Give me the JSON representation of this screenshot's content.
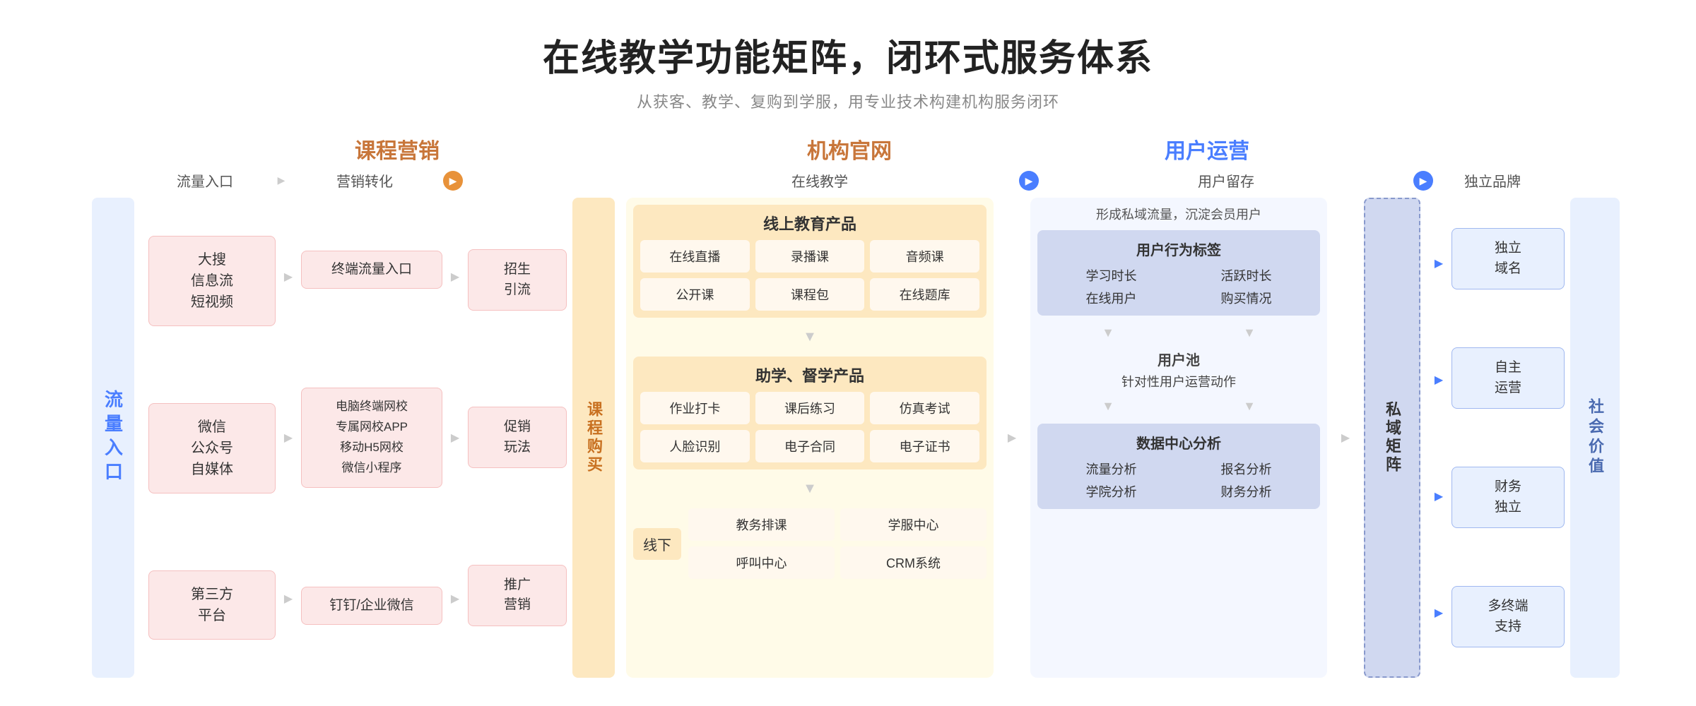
{
  "header": {
    "title": "在线教学功能矩阵，闭环式服务体系",
    "subtitle": "从获客、教学、复购到学服，用专业技术构建机构服务闭环"
  },
  "sections": {
    "marketing_label": "课程营销",
    "official_label": "机构官网",
    "user_ops_label": "用户运营"
  },
  "flow_steps": {
    "step1": "流量入口",
    "step2": "营销转化",
    "step3": "在线教学",
    "step4": "用户留存",
    "step5": "独立品牌"
  },
  "left_label": "流量入口",
  "flow_entries": [
    "大搜\n信息流\n短视频",
    "微信\n公众号\n自媒体",
    "第三方\n平台"
  ],
  "marketing_items": [
    "终端流量入口",
    "电脑终端网校\n专属网校APP\n移动H5网校\n微信小程序",
    "钉钉/企业微信"
  ],
  "purchase_items": [
    "招生\n引流",
    "促销\n玩法",
    "推广\n营销"
  ],
  "course_buy_label": "课程购买",
  "online_teaching": {
    "section1_title": "线上教育产品",
    "section1_items": [
      "在线直播",
      "录播课",
      "音频课",
      "公开课",
      "课程包",
      "在线题库"
    ],
    "section2_title": "助学、督学产品",
    "section2_items": [
      "作业打卡",
      "课后练习",
      "仿真考试",
      "人脸识别",
      "电子合同",
      "电子证书"
    ],
    "offline_label": "线下",
    "offline_items": [
      "教务排课",
      "学服中心",
      "呼叫中心",
      "CRM系统"
    ]
  },
  "user_retention": {
    "top_text": "形成私域流量，沉淀会员用户",
    "behavior_title": "用户行为标签",
    "behavior_items": [
      "学习时长",
      "活跃时长",
      "在线用户",
      "购买情况"
    ],
    "user_pool_title": "用户池",
    "user_pool_sub": "针对性用户运营动作",
    "data_center_title": "数据中心分析",
    "data_items": [
      "流量分析",
      "报名分析",
      "学院分析",
      "财务分析"
    ]
  },
  "private_domain_label": "私域矩阵",
  "user_ops_items": [
    "独立\n域名",
    "自主\n运营",
    "财务\n独立",
    "多终端\n支持"
  ],
  "social_value_label": "社会价值",
  "arrows": {
    "orange": "▶",
    "blue": "▶",
    "down": "▼"
  }
}
